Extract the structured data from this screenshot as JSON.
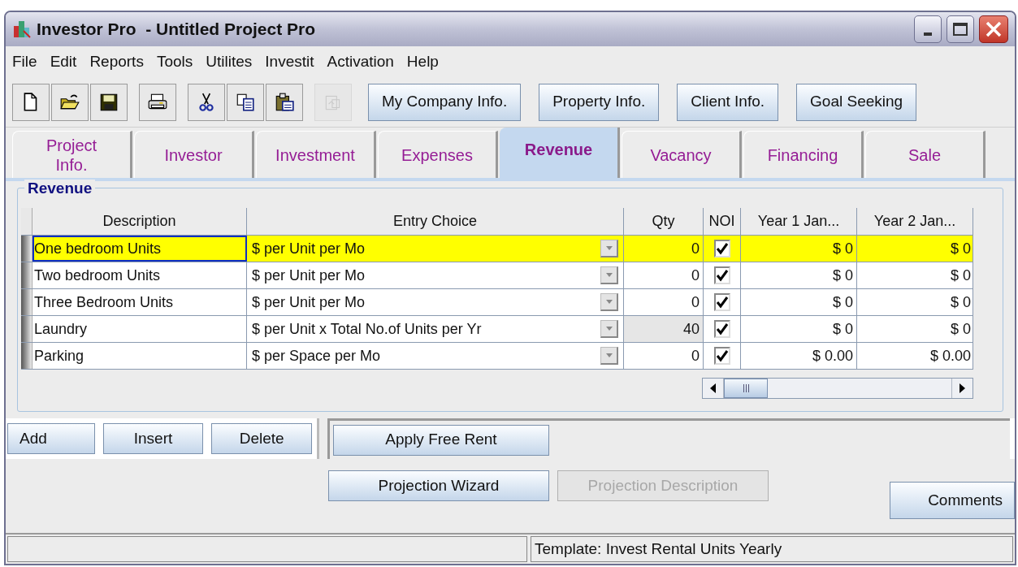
{
  "window": {
    "title": "Investor Pro  - Untitled Project Pro"
  },
  "menu": [
    "File",
    "Edit",
    "Reports",
    "Tools",
    "Utilites",
    "Investit",
    "Activation",
    "Help"
  ],
  "toolbar": {
    "icons": [
      {
        "kind": "new",
        "disabled": false
      },
      {
        "kind": "open",
        "disabled": false
      },
      {
        "kind": "save",
        "disabled": false
      },
      {
        "kind": "print",
        "disabled": false
      },
      {
        "kind": "cut",
        "disabled": false
      },
      {
        "kind": "copy",
        "disabled": false
      },
      {
        "kind": "paste",
        "disabled": false
      },
      {
        "kind": "export",
        "disabled": true
      }
    ],
    "buttons": [
      "My Company Info.",
      "Property Info.",
      "Client Info.",
      "Goal Seeking"
    ]
  },
  "tabs": [
    {
      "label": "Project\nInfo.",
      "selected": false
    },
    {
      "label": "Investor",
      "selected": false
    },
    {
      "label": "Investment",
      "selected": false
    },
    {
      "label": "Expenses",
      "selected": false
    },
    {
      "label": "Revenue",
      "selected": true
    },
    {
      "label": "Vacancy",
      "selected": false
    },
    {
      "label": "Financing",
      "selected": false
    },
    {
      "label": "Sale",
      "selected": false
    }
  ],
  "group": {
    "title": "Revenue",
    "table": {
      "columns": [
        "Description",
        "Entry Choice",
        "Qty",
        "NOI",
        "Year 1 Jan...",
        "Year 2 Jan..."
      ],
      "rows": [
        {
          "description": "One bedroom Units",
          "entry_choice": "$ per Unit per Mo",
          "qty": "0",
          "qty_readonly": false,
          "noi_checked": true,
          "year_1": "$ 0",
          "year_2": "$ 0",
          "selected": true
        },
        {
          "description": "Two bedroom Units",
          "entry_choice": "$ per Unit per Mo",
          "qty": "0",
          "qty_readonly": false,
          "noi_checked": true,
          "year_1": "$ 0",
          "year_2": "$ 0",
          "selected": false
        },
        {
          "description": "Three Bedroom Units",
          "entry_choice": "$ per Unit per Mo",
          "qty": "0",
          "qty_readonly": false,
          "noi_checked": true,
          "year_1": "$ 0",
          "year_2": "$ 0",
          "selected": false
        },
        {
          "description": "Laundry",
          "entry_choice": "$ per Unit x Total No.of Units per Yr",
          "qty": "40",
          "qty_readonly": true,
          "noi_checked": true,
          "year_1": "$ 0",
          "year_2": "$ 0",
          "selected": false
        },
        {
          "description": "Parking",
          "entry_choice": "$ per Space per Mo",
          "qty": "0",
          "qty_readonly": false,
          "noi_checked": true,
          "year_1": "$ 0.00",
          "year_2": "$ 0.00",
          "selected": false
        }
      ]
    }
  },
  "row_buttons": [
    "Add",
    "Insert",
    "Delete"
  ],
  "free_rent_button": "Apply Free Rent",
  "projection_buttons": [
    {
      "label": "Projection Wizard",
      "disabled": false
    },
    {
      "label": "Projection Description",
      "disabled": true
    }
  ],
  "comments_button": "Comments",
  "status_bar": {
    "template": "Template: Invest Rental Units Yearly"
  }
}
